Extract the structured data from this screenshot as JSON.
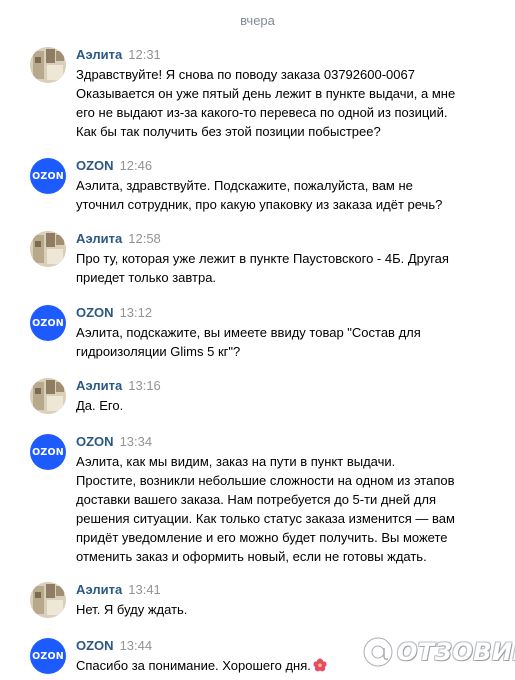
{
  "date_separator": "вчера",
  "messages": [
    {
      "author": "Аэлита",
      "time": "12:31",
      "avatar": "user-photo-avatar",
      "text": "Здравствуйте! Я снова по поводу заказа 03792600-0067\nОказывается он уже пятый день лежит в пункте выдачи, а мне\nего не выдают из-за какого-то перевеса по одной из позиций.\nКак бы так получить без этой позиции побыстрее?"
    },
    {
      "author": "OZON",
      "time": "12:46",
      "avatar": "ozon-logo-avatar",
      "text": "Аэлита, здравствуйте. Подскажите, пожалуйста, вам не\nуточнил сотрудник, про какую упаковку из заказа идёт речь?"
    },
    {
      "author": "Аэлита",
      "time": "12:58",
      "avatar": "user-photo-avatar",
      "text": "Про ту, которая уже лежит в пункте Паустовского - 4Б. Другая\nприедет только завтра."
    },
    {
      "author": "OZON",
      "time": "13:12",
      "avatar": "ozon-logo-avatar",
      "text": "Аэлита, подскажите, вы имеете ввиду товар \"Состав для\nгидроизоляции Glims 5 кг\"?"
    },
    {
      "author": "Аэлита",
      "time": "13:16",
      "avatar": "user-photo-avatar",
      "text": "Да. Его."
    },
    {
      "author": "OZON",
      "time": "13:34",
      "avatar": "ozon-logo-avatar",
      "text": "Аэлита, как мы видим, заказ на пути в пункт выдачи.\nПростите, возникли небольшие сложности на одном из этапов\nдоставки вашего заказа. Нам потребуется до 5-ти дней для\nрешения ситуации. Как только статус заказа изменится — вам\nпридёт уведомление и его можно будет получить. Вы можете\nотменить заказ и оформить новый, если не готовы ждать."
    },
    {
      "author": "Аэлита",
      "time": "13:41",
      "avatar": "user-photo-avatar",
      "text": "Нет. Я буду ждать."
    },
    {
      "author": "OZON",
      "time": "13:44",
      "avatar": "ozon-logo-avatar",
      "text": "Спасибо за понимание. Хорошего дня.",
      "emoji": "hibiscus-emoji"
    }
  ],
  "ozon_logo_text": "OZON",
  "watermark": {
    "text": "ОТЗОВИК",
    "icon": "otzovik-at-icon"
  },
  "colors": {
    "author": "#2a5885",
    "time": "#939393",
    "date": "#818c99",
    "ozon_blue": "#1e5bff",
    "emoji": "#e84a6f"
  }
}
